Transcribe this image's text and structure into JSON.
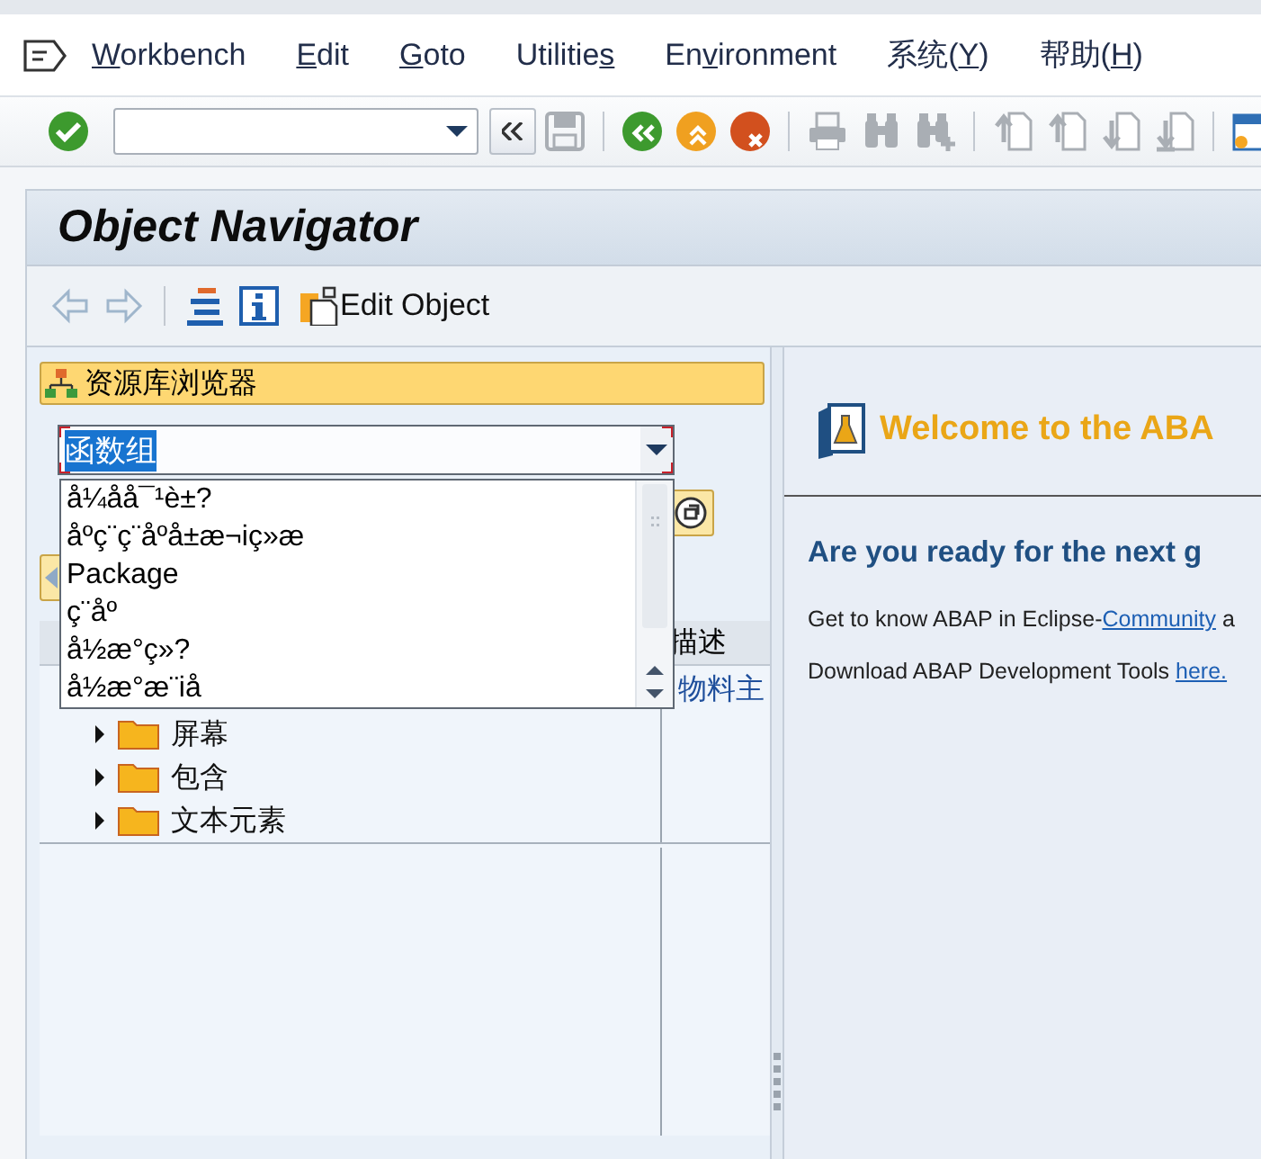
{
  "menu_bar": {
    "items": [
      {
        "key": "W",
        "post": "orkbench"
      },
      {
        "key": "E",
        "post": "dit"
      },
      {
        "key": "G",
        "post": "oto"
      },
      {
        "pre": "Utilitie",
        "key": "s"
      },
      {
        "pre": "En",
        "key": "v",
        "post": "ironment"
      },
      {
        "pre": "系统(",
        "key": "Y",
        "post": ")"
      },
      {
        "pre": "帮助(",
        "key": "H",
        "post": ")"
      }
    ]
  },
  "toolbar": {
    "items": [
      {
        "kind": "check",
        "disabled": false
      },
      {
        "kind": "command-field",
        "expanded": false
      },
      {
        "kind": "collapse",
        "disabled": false
      },
      {
        "kind": "save",
        "disabled": true
      },
      {
        "kind": "separator"
      },
      {
        "kind": "back",
        "disabled": false
      },
      {
        "kind": "exit",
        "disabled": false
      },
      {
        "kind": "cancel",
        "disabled": false
      },
      {
        "kind": "separator"
      },
      {
        "kind": "print",
        "disabled": true
      },
      {
        "kind": "find",
        "disabled": true
      },
      {
        "kind": "find-next",
        "disabled": true
      },
      {
        "kind": "separator"
      },
      {
        "kind": "first-page",
        "disabled": true
      },
      {
        "kind": "previous-page",
        "disabled": true
      },
      {
        "kind": "next-page",
        "disabled": true
      },
      {
        "kind": "last-page",
        "disabled": true
      },
      {
        "kind": "separator"
      },
      {
        "kind": "layout",
        "disabled": false
      }
    ]
  },
  "window": {
    "title": "Object Navigator"
  },
  "app_toolbar": {
    "items": [
      {
        "kind": "back",
        "disabled": true
      },
      {
        "kind": "forward",
        "disabled": true
      },
      {
        "kind": "separator"
      },
      {
        "kind": "hierarchy",
        "disabled": false
      },
      {
        "kind": "info",
        "disabled": false
      },
      {
        "kind": "edit-object",
        "label": "Edit Object",
        "disabled": false
      }
    ]
  },
  "repository_browser": {
    "header": "资源库浏览器",
    "object_type": {
      "value": "函数组",
      "expanded": true,
      "options": [
        {
          "label": "å¼åå¯¹è±?",
          "selected": false
        },
        {
          "label": "åºç¨ç¨åºå±æ¬iç»æ",
          "selected": false
        },
        {
          "label": "Package",
          "selected": false
        },
        {
          "label": "ç¨åº",
          "selected": false
        },
        {
          "label": "å½æ°ç»?",
          "selected": false
        },
        {
          "label": "å½æ°æ¨iå",
          "selected": false
        }
      ]
    },
    "tree": {
      "columns": [
        {
          "label": "描述"
        }
      ],
      "rows": [
        {
          "description": "物料主"
        }
      ],
      "items": [
        {
          "label": "屏幕",
          "expanded": false
        },
        {
          "label": "包含",
          "expanded": false
        },
        {
          "label": "文本元素",
          "expanded": false
        }
      ]
    }
  },
  "welcome": {
    "title": "Welcome to the ABA",
    "heading": "Are you ready for the next g",
    "lines": [
      {
        "text": "Get to know ABAP in Eclipse-",
        "link": "Community",
        "after": " a"
      },
      {
        "text": "Download ABAP Development Tools ",
        "link": "here."
      }
    ]
  }
}
